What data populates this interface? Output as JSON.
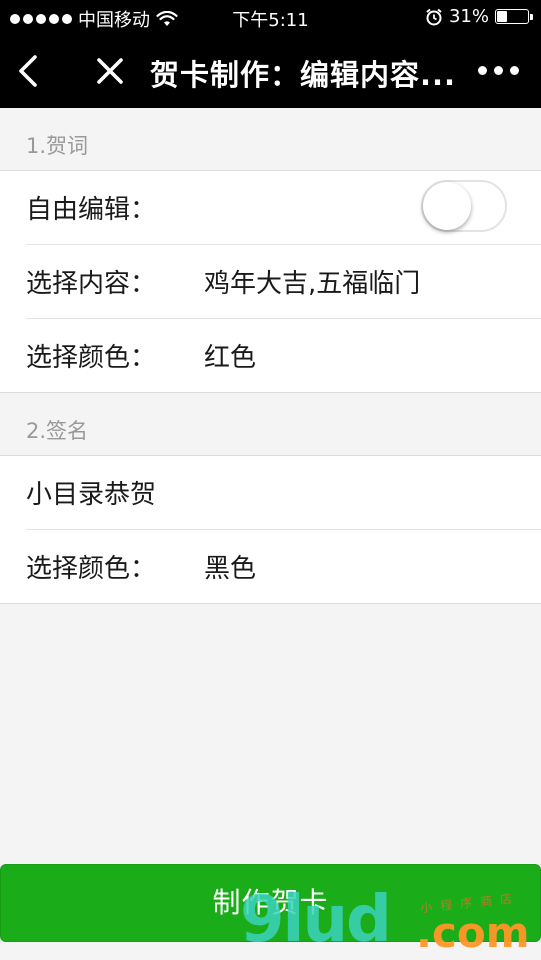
{
  "status_bar": {
    "carrier": "中国移动",
    "time": "下午5:11",
    "battery_percent": "31%",
    "battery_level": 0.31
  },
  "nav": {
    "title": "贺卡制作：编辑内容..."
  },
  "sections": [
    {
      "header": "1.贺词",
      "rows": [
        {
          "label": "自由编辑：",
          "toggle_on": false
        },
        {
          "label": "选择内容：",
          "value": "鸡年大吉,五福临门"
        },
        {
          "label": "选择颜色：",
          "value": "红色"
        }
      ]
    },
    {
      "header": "2.签名",
      "rows": [
        {
          "label": "小目录恭贺"
        },
        {
          "label": "选择颜色：",
          "value": "黑色"
        }
      ]
    }
  ],
  "primary_button": {
    "label": "制作贺卡"
  },
  "watermark": {
    "main": "9lud",
    "suffix": ".com",
    "sub": "小程序商店"
  },
  "colors": {
    "nav_background": "#000000",
    "primary_green": "#1aad19",
    "page_background": "#f4f4f4",
    "watermark_teal": "#3cd2be",
    "watermark_orange": "#ff9628"
  },
  "icons": {
    "back": "chevron-left-icon",
    "close": "close-icon",
    "more": "more-dots-icon",
    "wifi": "wifi-icon",
    "alarm": "alarm-clock-icon",
    "battery": "battery-icon",
    "signal": "signal-dots-icon"
  }
}
